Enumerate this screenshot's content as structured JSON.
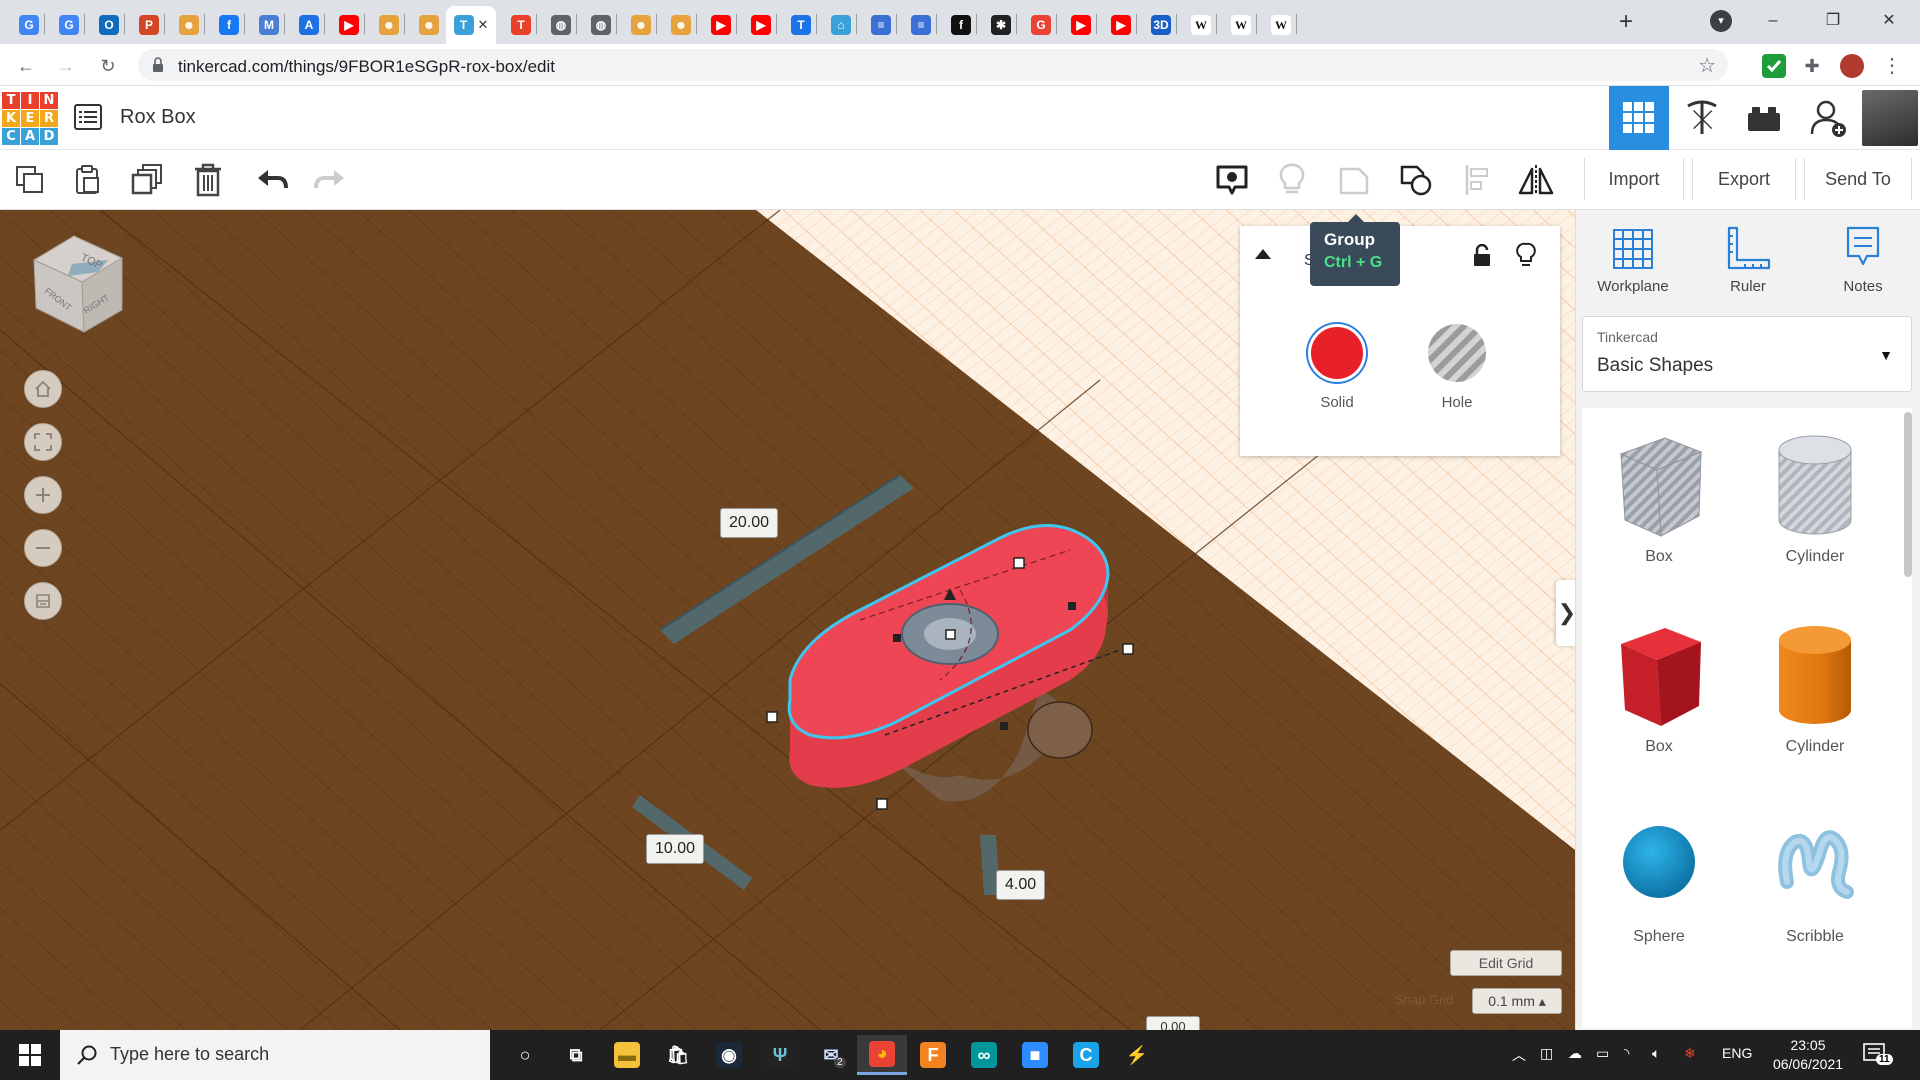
{
  "browser": {
    "tabs": [
      {
        "icon": "google-translate-icon",
        "color": "#4285f4",
        "glyph": "G"
      },
      {
        "icon": "google-translate-icon",
        "color": "#4285f4",
        "glyph": "G"
      },
      {
        "icon": "outlook-icon",
        "color": "#0f6cbd",
        "glyph": "O"
      },
      {
        "icon": "powerpoint-icon",
        "color": "#d24726",
        "glyph": "P"
      },
      {
        "icon": "helmet-icon",
        "color": "#e6a23c",
        "glyph": "☻"
      },
      {
        "icon": "facebook-icon",
        "color": "#1877f2",
        "glyph": "f"
      },
      {
        "icon": "m-icon",
        "color": "#4a7fd6",
        "glyph": "M"
      },
      {
        "icon": "a-icon",
        "color": "#1f6fe5",
        "glyph": "A"
      },
      {
        "icon": "youtube-icon",
        "color": "#ff0000",
        "glyph": "▶"
      },
      {
        "icon": "helmet-icon",
        "color": "#e6a23c",
        "glyph": "☻"
      },
      {
        "icon": "helmet-icon",
        "color": "#e6a23c",
        "glyph": "☻"
      },
      {
        "icon": "tinkercad-icon",
        "color": "#3aa0d8",
        "glyph": "T",
        "active": true
      },
      {
        "icon": "tinkercad-icon",
        "color": "#e8402a",
        "glyph": "T"
      },
      {
        "icon": "globe-icon",
        "color": "#5f6368",
        "glyph": "◍"
      },
      {
        "icon": "globe-icon",
        "color": "#5f6368",
        "glyph": "◍"
      },
      {
        "icon": "helmet-icon",
        "color": "#e6a23c",
        "glyph": "☻"
      },
      {
        "icon": "helmet-icon",
        "color": "#e6a23c",
        "glyph": "☻"
      },
      {
        "icon": "youtube-icon",
        "color": "#ff0000",
        "glyph": "▶"
      },
      {
        "icon": "youtube-icon",
        "color": "#ff0000",
        "glyph": "▶"
      },
      {
        "icon": "t-icon",
        "color": "#1a73e8",
        "glyph": "T"
      },
      {
        "icon": "doc-icon",
        "color": "#3aa0d8",
        "glyph": "⌂"
      },
      {
        "icon": "stack-icon",
        "color": "#3b6fd6",
        "glyph": "≡"
      },
      {
        "icon": "stack-icon",
        "color": "#3b6fd6",
        "glyph": "≡"
      },
      {
        "icon": "f-icon",
        "color": "#111111",
        "glyph": "f"
      },
      {
        "icon": "bug-icon",
        "color": "#222222",
        "glyph": "✱"
      },
      {
        "icon": "google-icon",
        "color": "#ea4335",
        "glyph": "G"
      },
      {
        "icon": "youtube-icon",
        "color": "#ff0000",
        "glyph": "▶"
      },
      {
        "icon": "youtube-icon",
        "color": "#ff0000",
        "glyph": "▶"
      },
      {
        "icon": "3d-icon",
        "color": "#1a5fc8",
        "glyph": "3D"
      },
      {
        "icon": "wikipedia-icon",
        "color": "#ffffff",
        "glyph": "W"
      },
      {
        "icon": "wikipedia-icon",
        "color": "#ffffff",
        "glyph": "W"
      },
      {
        "icon": "wikipedia-icon",
        "color": "#ffffff",
        "glyph": "W"
      }
    ],
    "new_tab": "+",
    "url": "tinkercad.com/things/9FBOR1eSGpR-rox-box/edit",
    "window_controls": [
      "–",
      "❐",
      "✕"
    ]
  },
  "app": {
    "logo_letters": [
      "T",
      "I",
      "N",
      "K",
      "E",
      "R",
      "C",
      "A",
      "D"
    ],
    "logo_colors": [
      "#e8402a",
      "#e8402a",
      "#e8402a",
      "#f4a61c",
      "#f4a61c",
      "#f4a61c",
      "#3aa0d8",
      "#3aa0d8",
      "#3aa0d8"
    ],
    "design_name": "Rox Box",
    "accent": "#2a8ee0"
  },
  "toolbar": {
    "import_label": "Import",
    "export_label": "Export",
    "sendto_label": "Send To"
  },
  "inspector": {
    "title_fragment": "S",
    "solid_label": "Solid",
    "hole_label": "Hole",
    "solid_color": "#e8202a"
  },
  "tooltip": {
    "title": "Group",
    "shortcut": "Ctrl + G"
  },
  "viewcube": {
    "top": "TOP",
    "front": "FRONT",
    "right": "RIGHT"
  },
  "dimensions": {
    "length": "20.00",
    "width": "10.00",
    "height": "4.00",
    "elevation": "0.00"
  },
  "grid": {
    "edit_grid_label": "Edit Grid",
    "snap_label": "Snap Grid",
    "snap_value": "0.1 mm ▴"
  },
  "right_panel": {
    "tools": [
      {
        "label": "Workplane",
        "icon": "workplane-icon"
      },
      {
        "label": "Ruler",
        "icon": "ruler-icon"
      },
      {
        "label": "Notes",
        "icon": "notes-icon"
      }
    ],
    "library_owner": "Tinkercad",
    "library_name": "Basic Shapes",
    "shapes": [
      {
        "label": "Box",
        "icon": "box-hole-icon"
      },
      {
        "label": "Cylinder",
        "icon": "cylinder-hole-icon"
      },
      {
        "label": "Box",
        "icon": "box-icon"
      },
      {
        "label": "Cylinder",
        "icon": "cylinder-icon"
      },
      {
        "label": "Sphere",
        "icon": "sphere-icon"
      },
      {
        "label": "Scribble",
        "icon": "scribble-icon"
      }
    ]
  },
  "taskbar": {
    "search_placeholder": "Type here to search",
    "apps": [
      "cortana-icon",
      "task-view-icon",
      "file-explorer-icon",
      "store-icon",
      "steam-icon",
      "predator-icon",
      "mail-icon",
      "chrome-icon",
      "fusion-icon",
      "arduino-icon",
      "zoom-icon",
      "c-icon",
      "bolt-icon"
    ],
    "mail_badge": "2",
    "language": "ENG",
    "time": "23:05",
    "date": "06/06/2021",
    "notification_count": "11"
  }
}
